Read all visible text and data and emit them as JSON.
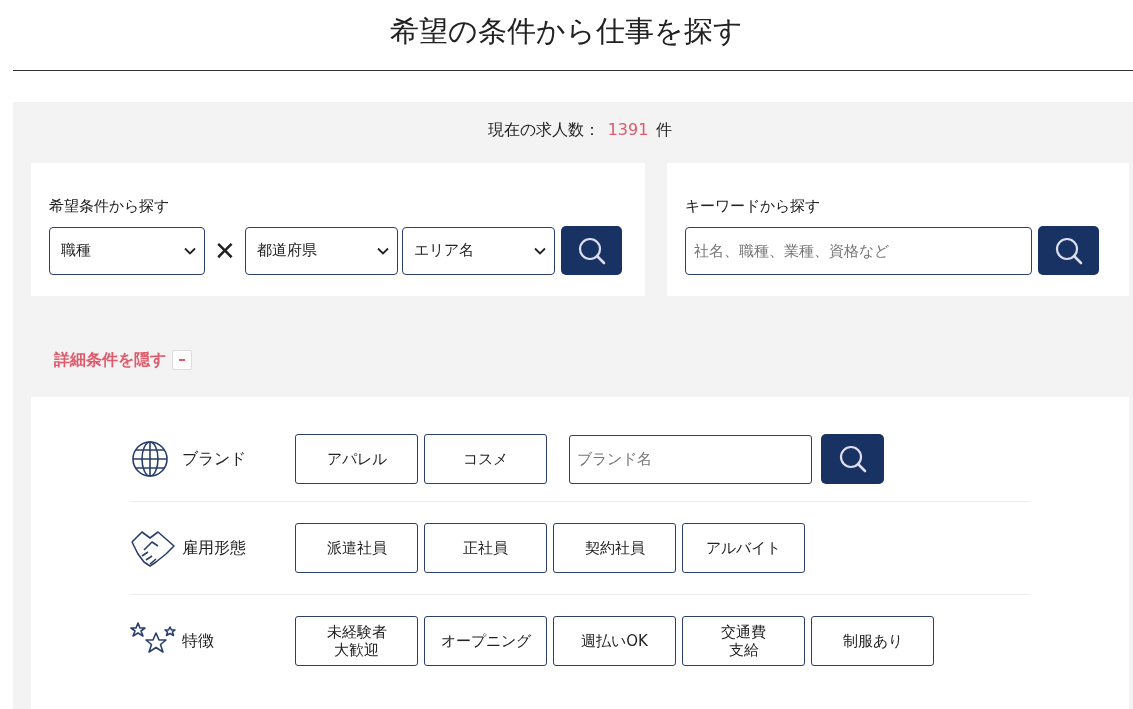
{
  "page_title": "希望の条件から仕事を探す",
  "job_count": {
    "label": "現在の求人数：",
    "value": "1391",
    "unit": "件"
  },
  "condition_search": {
    "heading": "希望条件から探す",
    "selects": [
      {
        "value": "職種"
      },
      {
        "value": "都道府県"
      },
      {
        "value": "エリア名"
      }
    ],
    "separator": "✕"
  },
  "keyword_search": {
    "heading": "キーワードから探す",
    "placeholder": "社名、職種、業種、資格など"
  },
  "detail_toggle": {
    "label": "詳細条件を隠す",
    "expanded": true
  },
  "filter_rows": [
    {
      "kind": "brand",
      "label": "ブランド",
      "options": [
        "アパレル",
        "コスメ"
      ],
      "search": {
        "placeholder": "ブランド名"
      }
    },
    {
      "kind": "employment",
      "label": "雇用形態",
      "options": [
        "派遣社員",
        "正社員",
        "契約社員",
        "アルバイト"
      ]
    },
    {
      "kind": "features",
      "label": "特徴",
      "options": [
        [
          "未経験者",
          "大歓迎"
        ],
        "オープニング",
        "週払いOK",
        [
          "交通費",
          "支給"
        ],
        "制服あり"
      ]
    }
  ]
}
